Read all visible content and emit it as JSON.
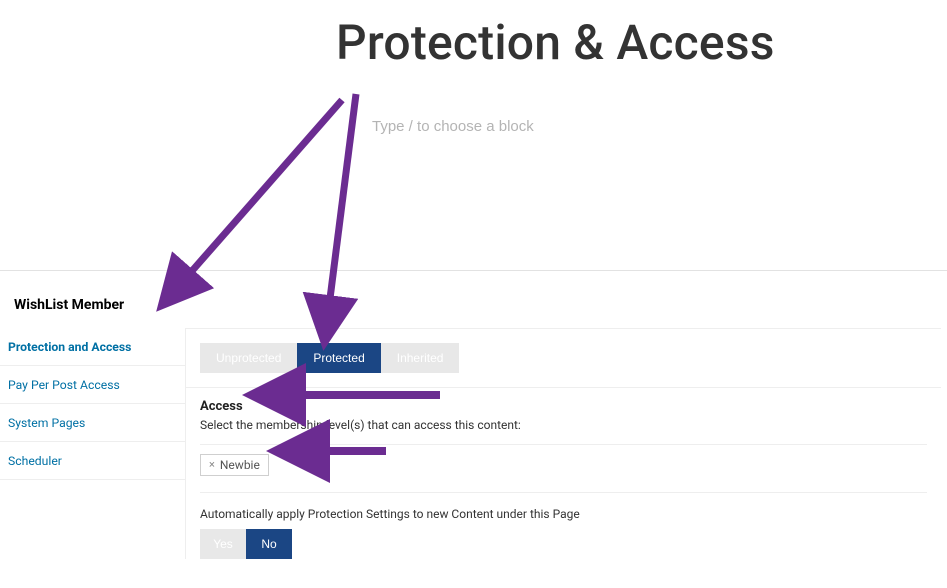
{
  "header": {
    "title": "Protection & Access",
    "placeholder": "Type / to choose a block"
  },
  "sidebar": {
    "title": "WishList Member",
    "items": [
      {
        "label": "Protection and Access",
        "active": true
      },
      {
        "label": "Pay Per Post Access",
        "active": false
      },
      {
        "label": "System Pages",
        "active": false
      },
      {
        "label": "Scheduler",
        "active": false
      }
    ]
  },
  "tabs": [
    {
      "label": "Unprotected",
      "active": false
    },
    {
      "label": "Protected",
      "active": true
    },
    {
      "label": "Inherited",
      "active": false
    }
  ],
  "access": {
    "heading": "Access",
    "description": "Select the membership level(s) that can access this content:",
    "levels": [
      {
        "name": "Newbie"
      }
    ]
  },
  "auto_apply": {
    "description": "Automatically apply Protection Settings to new Content under this Page",
    "options": [
      {
        "label": "Yes",
        "active": false
      },
      {
        "label": "No",
        "active": true
      }
    ]
  }
}
